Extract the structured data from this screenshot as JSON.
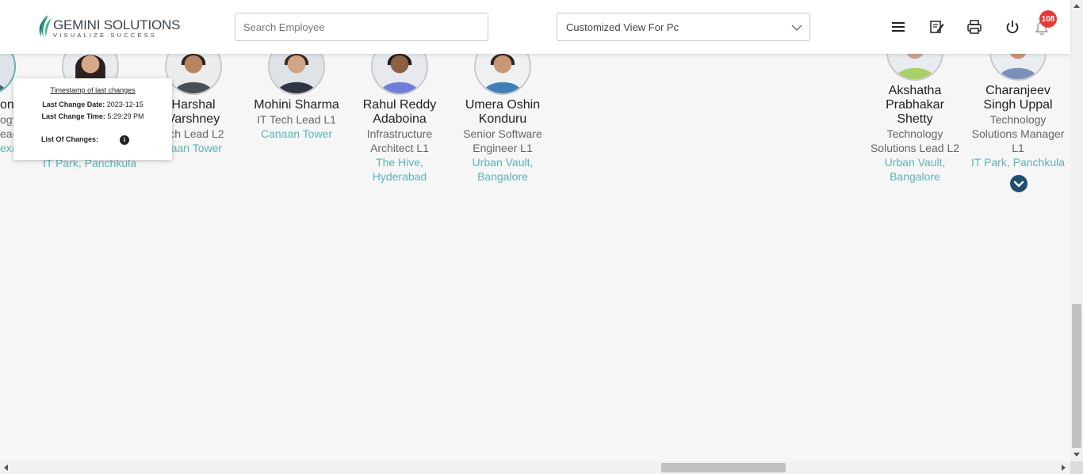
{
  "header": {
    "logo_name": "GEMINI SOLUTIONS",
    "logo_tagline": "VISUALIZE SUCCESS",
    "search_placeholder": "Search Employee",
    "view_select_value": "Customized View For Pc",
    "notification_count": "108",
    "icons": [
      "menu-icon",
      "edit-note-icon",
      "print-icon",
      "power-icon",
      "bell-icon"
    ]
  },
  "popover": {
    "title": "Timestamp of last changes",
    "date_label": "Last Change Date:",
    "date_value": "2023-12-15",
    "time_label": "Last Change Time:",
    "time_value": "5:29:29 PM",
    "changes_label": "List Of Changes:"
  },
  "partial_card": {
    "name_frag": "onc",
    "role_frag_1": "ogy",
    "role_frag_2": "ead",
    "loc_frag": "exa"
  },
  "hidden_card": {
    "location_frag": "IT Park, Panchkula"
  },
  "employees": [
    {
      "name": [
        "Harshal",
        "Varshney"
      ],
      "role": [
        "ech Lead L2"
      ],
      "location": [
        "naan Tower"
      ]
    },
    {
      "name": [
        "Mohini Sharma"
      ],
      "role": [
        "IT Tech Lead L1"
      ],
      "location": [
        "Canaan Tower"
      ]
    },
    {
      "name": [
        "Rahul Reddy",
        "Adaboina"
      ],
      "role": [
        "Infrastructure",
        "Architect L1"
      ],
      "location": [
        "The Hive,",
        "Hyderabad"
      ]
    },
    {
      "name": [
        "Umera Oshin",
        "Konduru"
      ],
      "role": [
        "Senior Software",
        "Engineer L1"
      ],
      "location": [
        "Urban Vault,",
        "Bangalore"
      ]
    },
    {
      "name": [
        "Akshatha",
        "Prabhakar",
        "Shetty"
      ],
      "role": [
        "Technology",
        "Solutions Lead L2"
      ],
      "location": [
        "Urban Vault,",
        "Bangalore"
      ]
    },
    {
      "name": [
        "Charanjeev",
        "Singh Uppal"
      ],
      "role": [
        "Technology",
        "Solutions Manager",
        "L1"
      ],
      "location": [
        "IT Park, Panchkula"
      ]
    }
  ],
  "colors": {
    "accent_location": "#5cb3b7",
    "badge": "#e53935",
    "expand_button": "#1f4e72"
  }
}
